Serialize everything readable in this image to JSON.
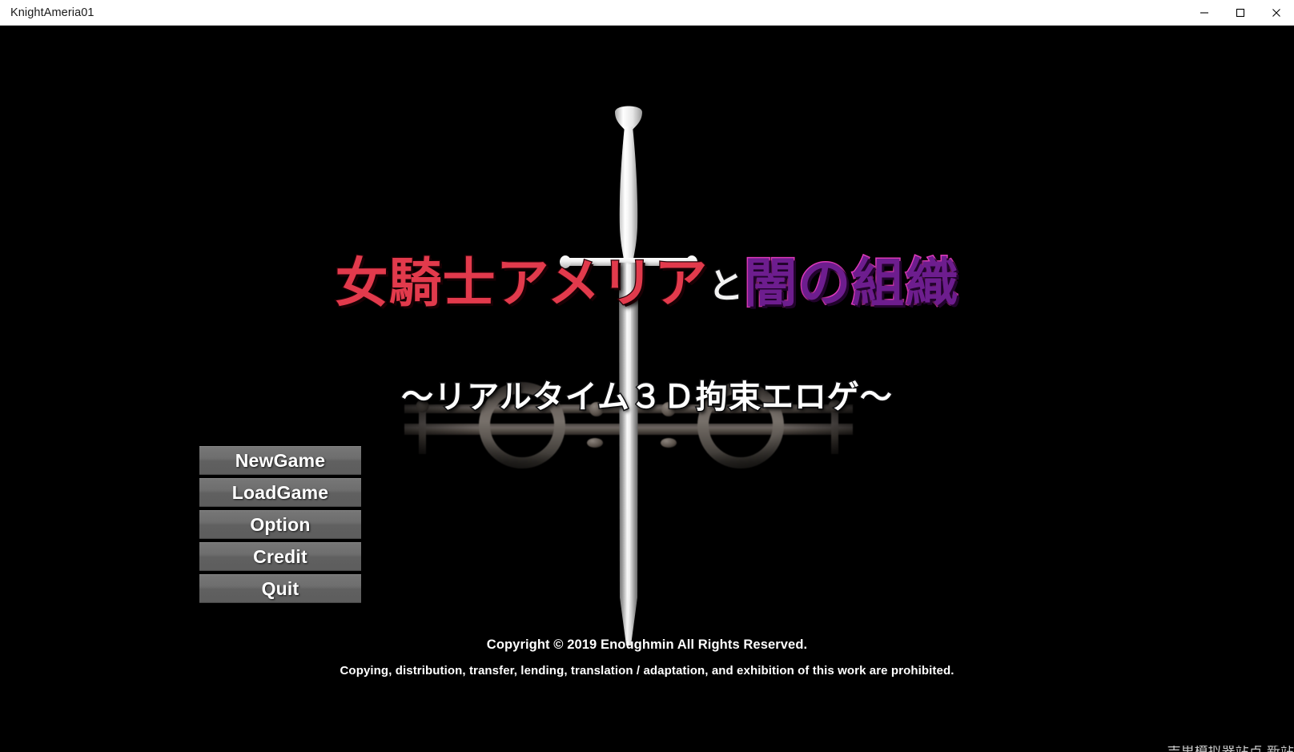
{
  "window": {
    "title": "KnightAmeria01",
    "controls": [
      {
        "name": "minimize",
        "glyph": "minimize-icon"
      },
      {
        "name": "maximize",
        "glyph": "maximize-icon"
      },
      {
        "name": "close",
        "glyph": "close-icon"
      }
    ]
  },
  "title_logo": {
    "part_red": "女騎士アメリア",
    "part_white": "と",
    "part_purple": "闇の組織",
    "subtitle": "〜リアルタイム３Ｄ拘束エロゲ〜",
    "color_red": "#e23a4c",
    "color_white": "#f2f2f2",
    "color_purple": "#6d1d8e",
    "color_purple_outline": "#e43bbf"
  },
  "menu": {
    "items": [
      {
        "label": "NewGame"
      },
      {
        "label": "LoadGame"
      },
      {
        "label": "Option"
      },
      {
        "label": "Credit"
      },
      {
        "label": "Quit"
      }
    ]
  },
  "footer": {
    "copyright": "Copyright © 2019 Enoughmin All Rights Reserved.",
    "prohibited": "Copying, distribution, transfer, lending, translation / adaptation, and exhibition of this work are prohibited."
  },
  "watermark": {
    "text": "吉里模拟器站点  新站"
  },
  "artwork": {
    "sword_name": "sword-illustration",
    "pillory_name": "pillory-stocks-illustration",
    "background_color": "#000000"
  }
}
